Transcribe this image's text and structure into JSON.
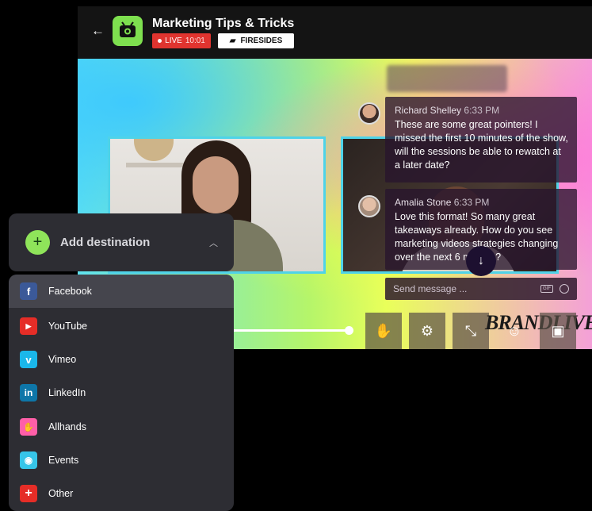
{
  "header": {
    "back_icon": "arrow-left-icon",
    "title": "Marketing Tips & Tricks",
    "live_label": "LIVE",
    "live_time": "10:01",
    "fireside_label": "FIRESIDES"
  },
  "chat": {
    "messages": [
      {
        "author": "Richard Shelley",
        "time": "6:33 PM",
        "text": "These are some great pointers! I missed the first 10 minutes of the show, will the sessions be able to rewatch at a later date?"
      },
      {
        "author": "Amalia Stone",
        "time": "6:33 PM",
        "text": "Love this format! So many great takeaways already. How do you see marketing videos strategies changing over the next 6 months?"
      }
    ],
    "send_placeholder": "Send message ...",
    "gif_label": "GIF"
  },
  "controls": {
    "brand": "BRANDLIVE"
  },
  "destination": {
    "add_label": "Add destination"
  },
  "menu": {
    "items": [
      {
        "label": "Facebook",
        "icon": "facebook-icon",
        "color": "#3b5998",
        "glyph": "f"
      },
      {
        "label": "YouTube",
        "icon": "youtube-icon",
        "color": "#e52d27",
        "glyph": "▶"
      },
      {
        "label": "Vimeo",
        "icon": "vimeo-icon",
        "color": "#1ab7ea",
        "glyph": "v"
      },
      {
        "label": "LinkedIn",
        "icon": "linkedin-icon",
        "color": "#0e76a8",
        "glyph": "in"
      },
      {
        "label": "Allhands",
        "icon": "allhands-icon",
        "color": "#ff5fa8",
        "glyph": "✋"
      },
      {
        "label": "Events",
        "icon": "events-icon",
        "color": "#36c5e8",
        "glyph": "◉"
      },
      {
        "label": "Other",
        "icon": "other-icon",
        "color": "#e52d27",
        "glyph": "+"
      }
    ]
  },
  "colors": {
    "accent_green": "#8fe45a",
    "live_red": "#e0342f",
    "panel": "#2d2d33"
  }
}
